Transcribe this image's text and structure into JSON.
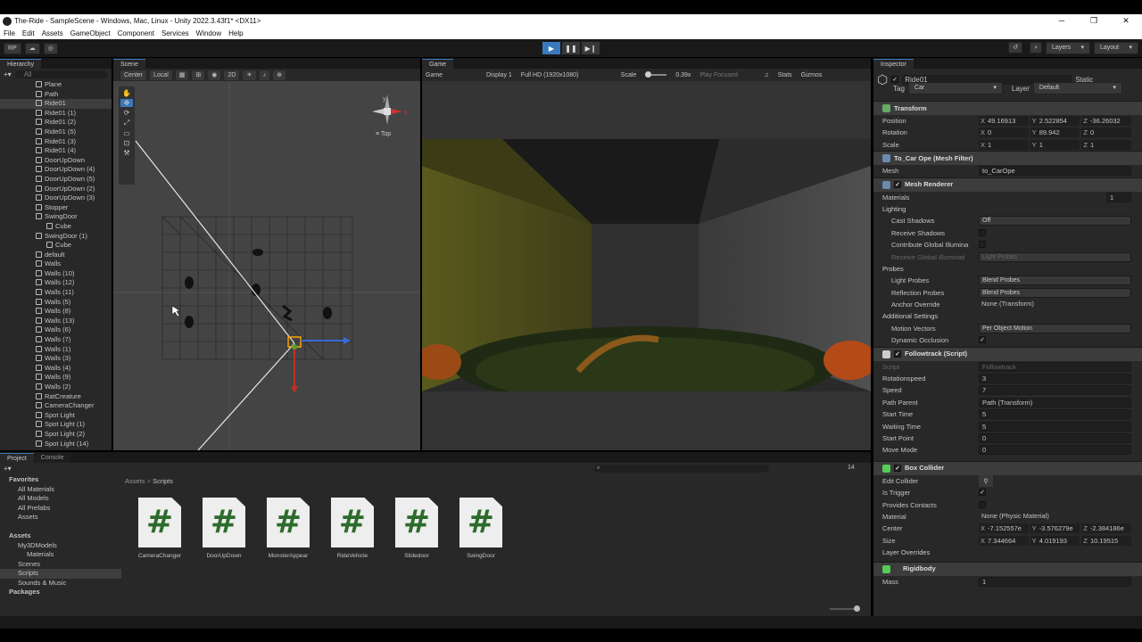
{
  "window": {
    "title": "The-Ride - SampleScene - Windows, Mac, Linux - Unity 2022.3.43f1* <DX11>",
    "min": "─",
    "max": "❐",
    "close": "✕"
  },
  "menu": [
    "File",
    "Edit",
    "Assets",
    "GameObject",
    "Component",
    "Services",
    "Window",
    "Help"
  ],
  "toolbar": {
    "account": "RP",
    "layers": "Layers",
    "layout": "Layout"
  },
  "hierarchy": {
    "tab": "Hierarchy",
    "search_placeholder": "All",
    "items": [
      {
        "label": "Plane",
        "depth": 1
      },
      {
        "label": "Path",
        "depth": 1
      },
      {
        "label": "Ride01",
        "depth": 1,
        "selected": true
      },
      {
        "label": "Ride01 (1)",
        "depth": 1
      },
      {
        "label": "Ride01 (2)",
        "depth": 1
      },
      {
        "label": "Ride01 (5)",
        "depth": 1
      },
      {
        "label": "Ride01 (3)",
        "depth": 1
      },
      {
        "label": "Ride01 (4)",
        "depth": 1
      },
      {
        "label": "DoorUpDown",
        "depth": 1
      },
      {
        "label": "DoorUpDown (4)",
        "depth": 1
      },
      {
        "label": "DoorUpDown (5)",
        "depth": 1
      },
      {
        "label": "DoorUpDown (2)",
        "depth": 1
      },
      {
        "label": "DoorUpDown (3)",
        "depth": 1
      },
      {
        "label": "Stopper",
        "depth": 1
      },
      {
        "label": "SwingDoor",
        "depth": 1
      },
      {
        "label": "Cube",
        "depth": 2
      },
      {
        "label": "SwingDoor (1)",
        "depth": 1
      },
      {
        "label": "Cube",
        "depth": 2
      },
      {
        "label": "default",
        "depth": 1
      },
      {
        "label": "Walls",
        "depth": 1
      },
      {
        "label": "Walls (10)",
        "depth": 1
      },
      {
        "label": "Walls (12)",
        "depth": 1
      },
      {
        "label": "Walls (11)",
        "depth": 1
      },
      {
        "label": "Walls (5)",
        "depth": 1
      },
      {
        "label": "Walls (8)",
        "depth": 1
      },
      {
        "label": "Walls (13)",
        "depth": 1
      },
      {
        "label": "Walls (6)",
        "depth": 1
      },
      {
        "label": "Walls (7)",
        "depth": 1
      },
      {
        "label": "Walls (1)",
        "depth": 1
      },
      {
        "label": "Walls (3)",
        "depth": 1
      },
      {
        "label": "Walls (4)",
        "depth": 1
      },
      {
        "label": "Walls (9)",
        "depth": 1
      },
      {
        "label": "Walls (2)",
        "depth": 1
      },
      {
        "label": "RatCreature",
        "depth": 1
      },
      {
        "label": "CameraChanger",
        "depth": 1
      },
      {
        "label": "Spot Light",
        "depth": 1
      },
      {
        "label": "Spot Light (1)",
        "depth": 1
      },
      {
        "label": "Spot Light (2)",
        "depth": 1
      },
      {
        "label": "Spot Light (14)",
        "depth": 1
      }
    ]
  },
  "scene": {
    "tab": "Scene",
    "pivot": "Center",
    "space": "Local",
    "mode2d": "2D",
    "view": "Top"
  },
  "game": {
    "tab": "Game",
    "mode": "Game",
    "display": "Display 1",
    "resolution": "Full HD (1920x1080)",
    "scale_label": "Scale",
    "scale": "0.39x",
    "play_focused": "Play Focused",
    "stats": "Stats",
    "gizmos": "Gizmos"
  },
  "inspector": {
    "tab": "Inspector",
    "object_name": "Ride01",
    "static": "Static",
    "tag_label": "Tag",
    "tag": "Car",
    "layer_label": "Layer",
    "layer": "Default",
    "transform": {
      "title": "Transform",
      "position": [
        "49.16913",
        "2.522854",
        "-36.26032"
      ],
      "rotation": [
        "0",
        "89.942",
        "0"
      ],
      "scale": [
        "1",
        "1",
        "1"
      ],
      "pos_label": "Position",
      "rot_label": "Rotation",
      "scale_label": "Scale"
    },
    "meshfilter": {
      "title": "To_Car Ope (Mesh Filter)",
      "mesh_label": "Mesh",
      "mesh": "to_CarOpe"
    },
    "meshrenderer": {
      "title": "Mesh Renderer",
      "materials": "Materials",
      "materials_count": "1",
      "lighting": "Lighting",
      "cast_shadows_label": "Cast Shadows",
      "cast_shadows": "Off",
      "receive_shadows": "Receive Shadows",
      "contribute_gi": "Contribute Global Illumina",
      "receive_gi": "Receive Global Illuminati",
      "receive_gi_val": "Light Probes",
      "probes": "Probes",
      "light_probes_label": "Light Probes",
      "light_probes": "Blend Probes",
      "refl_probes_label": "Reflection Probes",
      "refl_probes": "Blend Probes",
      "anchor_label": "Anchor Override",
      "anchor": "None (Transform)",
      "additional": "Additional Settings",
      "motion_label": "Motion Vectors",
      "motion": "Per Object Motion",
      "dynocc_label": "Dynamic Occlusion"
    },
    "followtrack": {
      "title": "Followtrack (Script)",
      "script_label": "Script",
      "script": "Followtrack",
      "rotationspeed_label": "Rotationspeed",
      "rotationspeed": "3",
      "speed_label": "Speed",
      "speed": "7",
      "pathparent_label": "Path Parent",
      "pathparent": "Path (Transform)",
      "starttime_label": "Start Time",
      "starttime": "5",
      "waitingtime_label": "Waiting Time",
      "waitingtime": "5",
      "startpoint_label": "Start Point",
      "startpoint": "0",
      "movemode_label": "Move Mode",
      "movemode": "0"
    },
    "boxcollider": {
      "title": "Box Collider",
      "edit_label": "Edit Collider",
      "trigger_label": "Is Trigger",
      "provides_label": "Provides Contacts",
      "material_label": "Material",
      "material": "None (Physic Material)",
      "center_label": "Center",
      "center": [
        "-7.152557e",
        "-3.576279e",
        "-2.384186e"
      ],
      "size_label": "Size",
      "size": [
        "7.344664",
        "4.019193",
        "10.19515"
      ],
      "layer_overrides": "Layer Overrides"
    },
    "rigidbody": {
      "title": "Rigidbody",
      "mass_label": "Mass",
      "mass": "1"
    }
  },
  "project": {
    "tab": "Project",
    "console_tab": "Console",
    "breadcrumb": [
      "Assets",
      "Scripts"
    ],
    "count": "14",
    "tree": [
      {
        "label": "Favorites",
        "depth": 0,
        "bold": true
      },
      {
        "label": "All Materials",
        "depth": 1
      },
      {
        "label": "All Models",
        "depth": 1
      },
      {
        "label": "All Prefabs",
        "depth": 1
      },
      {
        "label": "Assets",
        "depth": 1
      },
      {
        "label": "",
        "depth": 0
      },
      {
        "label": "Assets",
        "depth": 0,
        "bold": true
      },
      {
        "label": "My3DModels",
        "depth": 1
      },
      {
        "label": "Materials",
        "depth": 2
      },
      {
        "label": "Scenes",
        "depth": 1
      },
      {
        "label": "Scripts",
        "depth": 1,
        "selected": true
      },
      {
        "label": "Sounds & Music",
        "depth": 1
      },
      {
        "label": "Packages",
        "depth": 0,
        "bold": true
      }
    ],
    "assets": [
      "CameraChanger",
      "DoorUpDown",
      "MonsterAppear",
      "RideVehicle",
      "Slidedoor",
      "SwingDoor"
    ],
    "asset_glyph": "#"
  }
}
